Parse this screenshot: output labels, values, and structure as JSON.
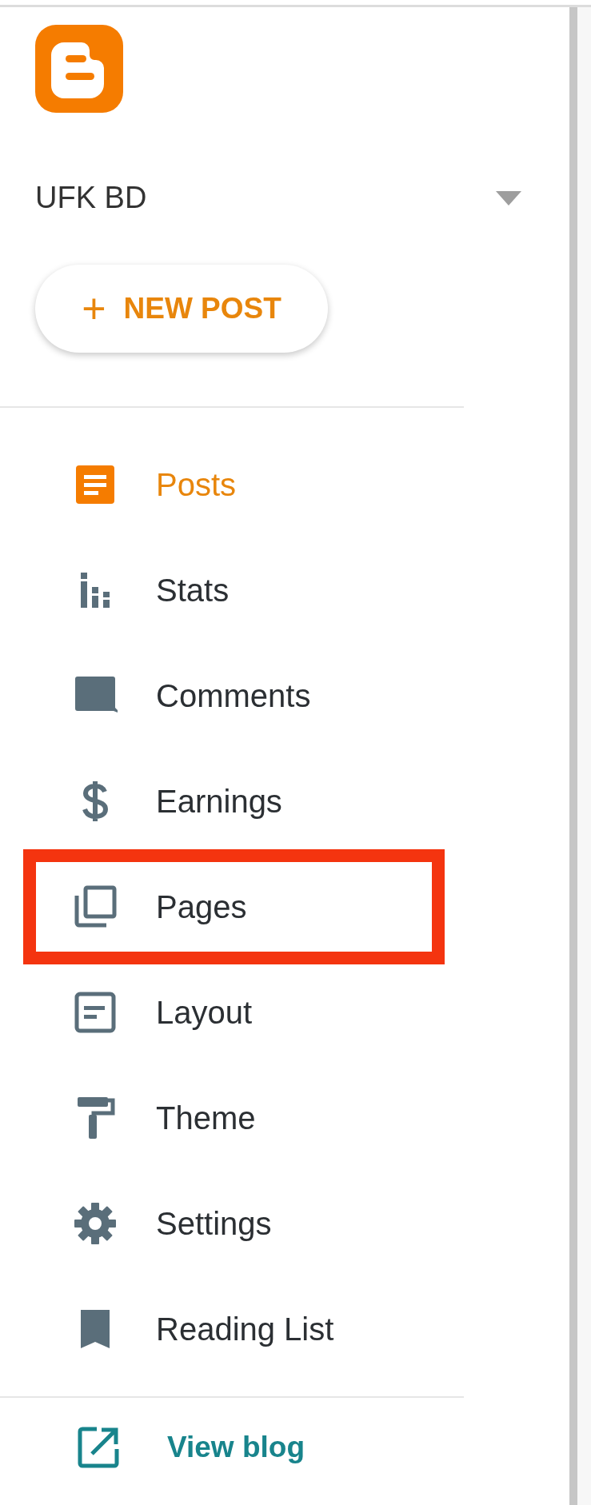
{
  "blog": {
    "name": "UFK BD"
  },
  "new_post": {
    "label": "NEW POST",
    "icon": "+"
  },
  "nav": [
    {
      "kind": "posts",
      "label": "Posts",
      "selected": true,
      "highlighted": false
    },
    {
      "kind": "stats",
      "label": "Stats",
      "selected": false,
      "highlighted": false
    },
    {
      "kind": "comments",
      "label": "Comments",
      "selected": false,
      "highlighted": false
    },
    {
      "kind": "earnings",
      "label": "Earnings",
      "selected": false,
      "highlighted": false
    },
    {
      "kind": "pages",
      "label": "Pages",
      "selected": false,
      "highlighted": true
    },
    {
      "kind": "layout",
      "label": "Layout",
      "selected": false,
      "highlighted": false
    },
    {
      "kind": "theme",
      "label": "Theme",
      "selected": false,
      "highlighted": false
    },
    {
      "kind": "settings",
      "label": "Settings",
      "selected": false,
      "highlighted": false
    },
    {
      "kind": "reading",
      "label": "Reading List",
      "selected": false,
      "highlighted": false
    }
  ],
  "view_blog": {
    "label": "View blog"
  }
}
